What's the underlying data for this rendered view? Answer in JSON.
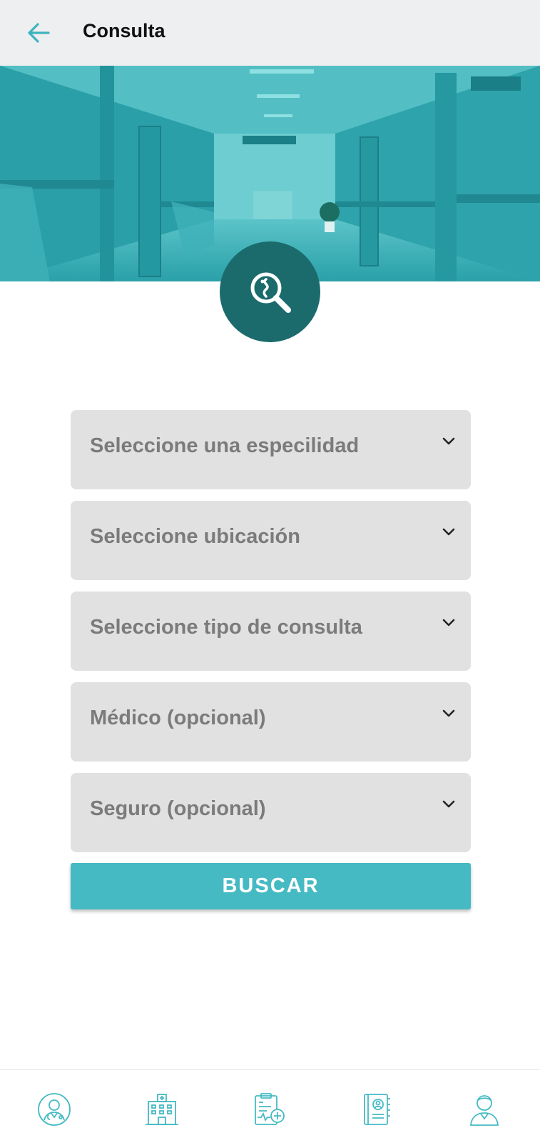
{
  "header": {
    "title": "Consulta",
    "back_icon": "arrow-left-icon"
  },
  "hero": {
    "image": "hospital-corridor",
    "tint_color": "#2fa7b0",
    "badge_icon": "search-medical-icon",
    "badge_color": "#1b6b6c"
  },
  "form": {
    "fields": [
      {
        "label": "Seleccione una especilidad"
      },
      {
        "label": "Seleccione ubicación"
      },
      {
        "label": "Seleccione tipo de consulta"
      },
      {
        "label": "Médico (opcional)"
      },
      {
        "label": "Seguro (opcional)"
      }
    ],
    "submit_label": "BUSCAR",
    "accent_color": "#45bac3"
  },
  "bottom_nav": {
    "items": [
      {
        "icon": "doctor-icon"
      },
      {
        "icon": "hospital-icon"
      },
      {
        "icon": "medical-record-icon"
      },
      {
        "icon": "contacts-book-icon"
      },
      {
        "icon": "user-profile-icon"
      }
    ]
  }
}
